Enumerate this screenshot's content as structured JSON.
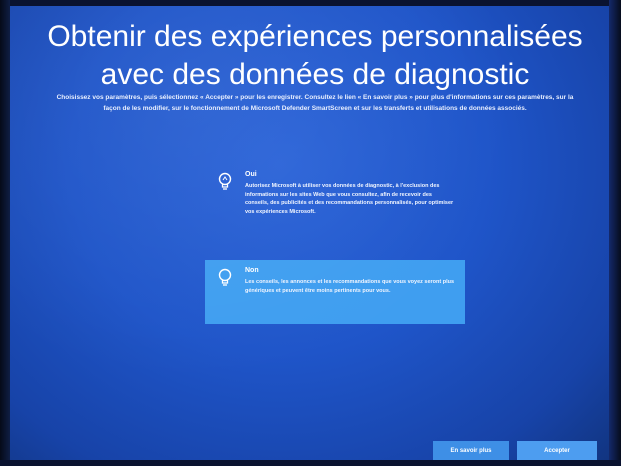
{
  "page": {
    "title": "Obtenir des expériences personnalisées avec des données de diagnostic",
    "subtitle": "Choisissez vos paramètres, puis sélectionnez « Accepter » pour les enregistrer. Consultez le lien « En savoir plus » pour plus d'informations sur ces paramètres, sur la façon de les modifier, sur le fonctionnement de Microsoft Defender SmartScreen et sur les transferts et utilisations de données associés."
  },
  "options": [
    {
      "label": "Oui",
      "description": "Autorisez Microsoft à utiliser vos données de diagnostic, à l'exclusion des informations sur les sites Web que vous consultez, afin de recevoir des conseils, des publicités et des recommandations personnalisés, pour optimiser vos expériences Microsoft.",
      "icon": "lightbulb-on-icon",
      "selected": false
    },
    {
      "label": "Non",
      "description": "Les conseils, les annonces et les recommandations que vous voyez seront plus génériques et peuvent être moins pertinents pour vous.",
      "icon": "lightbulb-off-icon",
      "selected": true
    }
  ],
  "buttons": {
    "learn_more": "En savoir plus",
    "accept": "Accepter"
  },
  "colors": {
    "background": "#1f55c9",
    "selected_option": "#3f9ef0",
    "button": "#4d9df0",
    "text": "#ffffff"
  }
}
